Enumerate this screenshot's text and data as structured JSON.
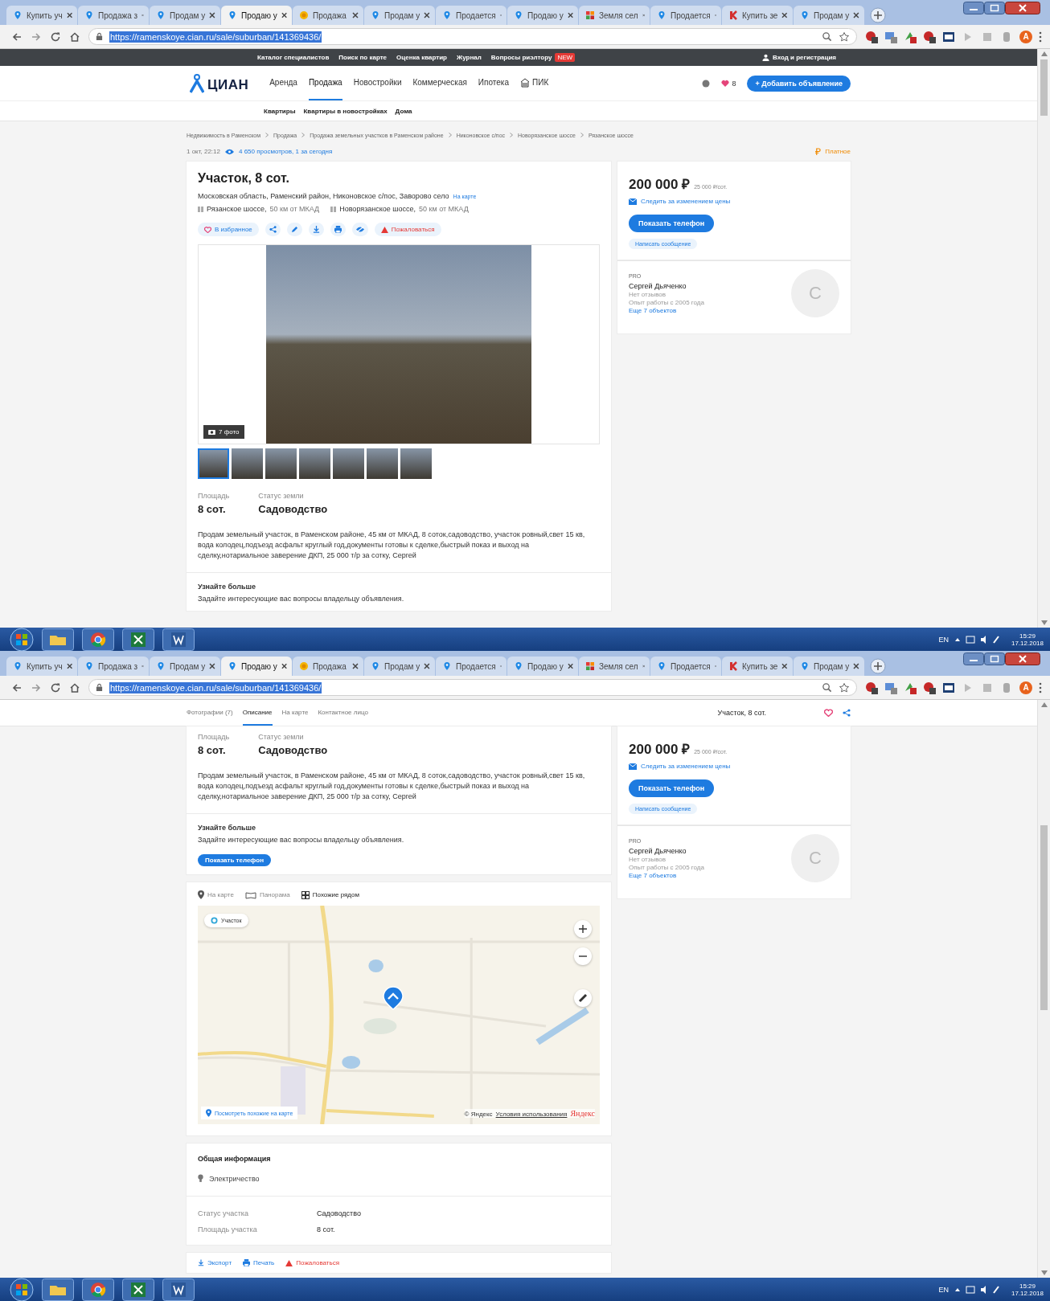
{
  "screen_1": {
    "browser": {
      "tabs": [
        {
          "title": "Купить уч",
          "kind": "pin",
          "selected": false
        },
        {
          "title": "Продажа з",
          "kind": "pin",
          "selected": false
        },
        {
          "title": "Продам у",
          "kind": "pin",
          "selected": false
        },
        {
          "title": "Продаю у",
          "kind": "pin",
          "selected": true
        },
        {
          "title": "Продажа",
          "kind": "coin",
          "selected": false
        },
        {
          "title": "Продам у",
          "kind": "pin",
          "selected": false
        },
        {
          "title": "Продается",
          "kind": "pin",
          "selected": false
        },
        {
          "title": "Продаю у",
          "kind": "pin",
          "selected": false
        },
        {
          "title": "Земля сел",
          "kind": "grid",
          "selected": false
        },
        {
          "title": "Продается",
          "kind": "pin",
          "selected": false
        },
        {
          "title": "Купить зе",
          "kind": "letter",
          "selected": false
        },
        {
          "title": "Продам у",
          "kind": "pin",
          "selected": false
        }
      ],
      "url": "https://ramenskoye.cian.ru/sale/suburban/141369436/",
      "profile": "A"
    },
    "topbar": {
      "links": [
        "Каталог специалистов",
        "Поиск по карте",
        "Оценка квартир",
        "Журнал",
        "Вопросы риэлтору"
      ],
      "badge": "NEW",
      "login": "Вход и регистрация"
    },
    "nav": {
      "logo": "ЦИАН",
      "items": [
        {
          "label": "Аренда",
          "selected": false,
          "kind": "text"
        },
        {
          "label": "Продажа",
          "selected": true,
          "kind": "text"
        },
        {
          "label": "Новостройки",
          "selected": false,
          "kind": "text"
        },
        {
          "label": "Коммерческая",
          "selected": false,
          "kind": "text"
        },
        {
          "label": "Ипотека",
          "selected": false,
          "kind": "text"
        },
        {
          "label": "ПИК",
          "selected": false,
          "kind": "pik"
        }
      ],
      "favorites_count": "8",
      "add_button": "+ Добавить объявление"
    },
    "subnav": [
      "Квартиры",
      "Квартиры в новостройках",
      "Дома"
    ],
    "breadcrumbs": [
      "Недвижимость в Раменском",
      "Продажа",
      "Продажа земельных участков в Раменском районе",
      "Никоновское с/пос",
      "Новорязанское шоссе",
      "Рязанское шоссе"
    ],
    "meta": {
      "date": "1 окт, 22:12",
      "views": "4 650 просмотров, 1 за сегодня",
      "paid": "Платное"
    },
    "listing": {
      "title": "Участок, 8 сот.",
      "address": "Московская область, Раменский район, Никоновское с/пос, Заворово село",
      "map_link": "На карте",
      "highways": [
        {
          "name": "Рязанское шоссе,",
          "distance": "50 км от МКАД"
        },
        {
          "name": "Новорязанское шоссе,",
          "distance": "50 км от МКАД"
        }
      ],
      "favorite": "В избранное",
      "complain": "Пожаловаться",
      "photo_count": "7 фото",
      "thumbnails": [
        {
          "selected": true
        },
        {
          "selected": false
        },
        {
          "selected": false
        },
        {
          "selected": false
        },
        {
          "selected": false
        },
        {
          "selected": false
        },
        {
          "selected": false
        }
      ],
      "facts": [
        {
          "label": "Площадь",
          "value": "8 сот."
        },
        {
          "label": "Статус земли",
          "value": "Садоводство"
        }
      ],
      "description": "Продам земельный участок, в Раменском районе, 45 км от МКАД, 8 соток,садоводство, участок ровный,свет 15 кв, вода колодец,подъезд асфальт круглый год,документы готовы к сделке,быстрый показ и выход на сделку,нотариальное заверение ДКП, 25 000 т/р за сотку, Сергей",
      "more_title": "Узнайте больше",
      "more_text": "Задайте интересующие вас вопросы владельцу объявления."
    },
    "price_card": {
      "price": "200 000 ₽",
      "per_unit": "25 000 ₽/сот.",
      "watch": "Следить за изменением цены",
      "phone_button": "Показать телефон",
      "message_button": "Написать сообщение"
    },
    "agent": {
      "badge": "PRO",
      "name": "Сергей Дьяченко",
      "reviews": "Нет отзывов",
      "experience": "Опыт работы с 2005 года",
      "more": "Еще 7 объектов",
      "initial": "С"
    },
    "taskbar": {
      "language": "EN",
      "time": "15:29",
      "date": "17.12.2018"
    }
  },
  "screen_2": {
    "browser": {
      "tabs": [
        {
          "title": "Купить уч",
          "kind": "pin",
          "selected": false
        },
        {
          "title": "Продажа з",
          "kind": "pin",
          "selected": false
        },
        {
          "title": "Продам у",
          "kind": "pin",
          "selected": false
        },
        {
          "title": "Продаю у",
          "kind": "pin",
          "selected": true
        },
        {
          "title": "Продажа",
          "kind": "coin",
          "selected": false
        },
        {
          "title": "Продам у",
          "kind": "pin",
          "selected": false
        },
        {
          "title": "Продается",
          "kind": "pin",
          "selected": false
        },
        {
          "title": "Продаю у",
          "kind": "pin",
          "selected": false
        },
        {
          "title": "Земля сел",
          "kind": "grid",
          "selected": false
        },
        {
          "title": "Продается",
          "kind": "pin",
          "selected": false
        },
        {
          "title": "Купить зе",
          "kind": "letter",
          "selected": false
        },
        {
          "title": "Продам у",
          "kind": "pin",
          "selected": false
        }
      ],
      "url": "https://ramenskoye.cian.ru/sale/suburban/141369436/",
      "profile": "A"
    },
    "sticky": {
      "tabs": [
        {
          "label": "Фотографии (7)",
          "selected": false
        },
        {
          "label": "Описание",
          "selected": true
        },
        {
          "label": "На карте",
          "selected": false
        },
        {
          "label": "Контактное лицо",
          "selected": false
        }
      ],
      "title": "Участок, 8 сот."
    },
    "listing": {
      "facts": [
        {
          "label": "Площадь",
          "value": "8 сот."
        },
        {
          "label": "Статус земли",
          "value": "Садоводство"
        }
      ],
      "description": "Продам земельный участок, в Раменском районе, 45 км от МКАД, 8 соток,садоводство, участок ровный,свет 15 кв, вода колодец,подъезд асфальт круглый год,документы готовы к сделке,быстрый показ и выход на сделку,нотариальное заверение ДКП, 25 000 т/р за сотку, Сергей",
      "more_title": "Узнайте больше",
      "more_text": "Задайте интересующие вас вопросы владельцу объявления.",
      "phone_button": "Показать телефон"
    },
    "map_section": {
      "tabs": [
        {
          "label": "На карте",
          "selected": false,
          "kind": "pin"
        },
        {
          "label": "Панорама",
          "selected": false,
          "kind": "panorama"
        },
        {
          "label": "Похожие рядом",
          "selected": true,
          "kind": "grid"
        }
      ],
      "chip": "Участок",
      "similar_link": "Посмотреть похожие на карте",
      "copyright": "© Яндекс",
      "terms": "Условия использования",
      "brand": "Яндекс"
    },
    "general": {
      "title": "Общая информация",
      "features": [
        "Электричество"
      ],
      "details": [
        {
          "label": "Статус участка",
          "value": "Садоводство"
        },
        {
          "label": "Площадь участка",
          "value": "8 сот."
        }
      ]
    },
    "footer_actions": [
      {
        "label": "Экспорт",
        "kind": "export"
      },
      {
        "label": "Печать",
        "kind": "print"
      },
      {
        "label": "Пожаловаться",
        "kind": "complain"
      }
    ],
    "price_card": {
      "price": "200 000 ₽",
      "per_unit": "25 000 ₽/сот.",
      "watch": "Следить за изменением цены",
      "phone_button": "Показать телефон",
      "message_button": "Написать сообщение"
    },
    "agent": {
      "badge": "PRO",
      "name": "Сергей Дьяченко",
      "reviews": "Нет отзывов",
      "experience": "Опыт работы с 2005 года",
      "more": "Еще 7 объектов",
      "initial": "С"
    },
    "taskbar": {
      "language": "EN",
      "time": "15:29",
      "date": "17.12.2018"
    }
  }
}
